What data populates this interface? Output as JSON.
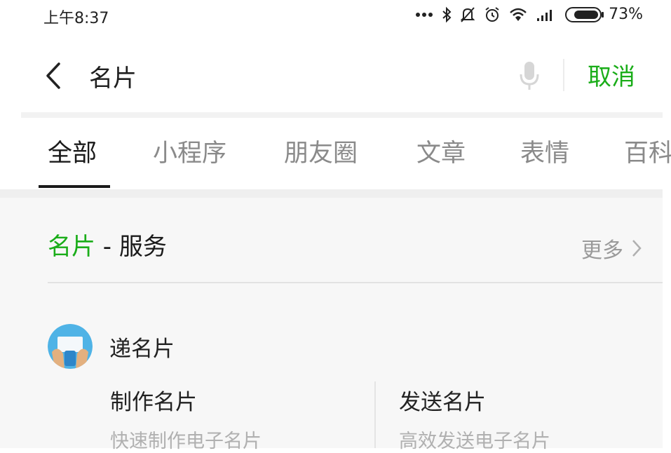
{
  "status_bar": {
    "time": "上午8:37",
    "battery": "73%",
    "icons": [
      "ellipsis-icon",
      "bluetooth-icon",
      "mute-icon",
      "alarm-icon",
      "wifi-icon",
      "signal-icon",
      "battery-icon"
    ]
  },
  "search": {
    "query": "名片",
    "cancel_label": "取消"
  },
  "tabs": [
    {
      "label": "全部",
      "active": true
    },
    {
      "label": "小程序",
      "active": false
    },
    {
      "label": "朋友圈",
      "active": false
    },
    {
      "label": "文章",
      "active": false
    },
    {
      "label": "表情",
      "active": false
    },
    {
      "label": "百科",
      "active": false
    }
  ],
  "section": {
    "keyword": "名片",
    "title_suffix": " - 服务",
    "more_label": "更多"
  },
  "service": {
    "name": "递名片",
    "items": [
      {
        "title": "制作名片",
        "desc": "快速制作电子名片"
      },
      {
        "title": "发送名片",
        "desc": "高效发送电子名片"
      }
    ]
  },
  "colors": {
    "accent_green": "#1aad19",
    "muted_text": "#8a8a8a",
    "section_bg": "#f7f7f7"
  }
}
